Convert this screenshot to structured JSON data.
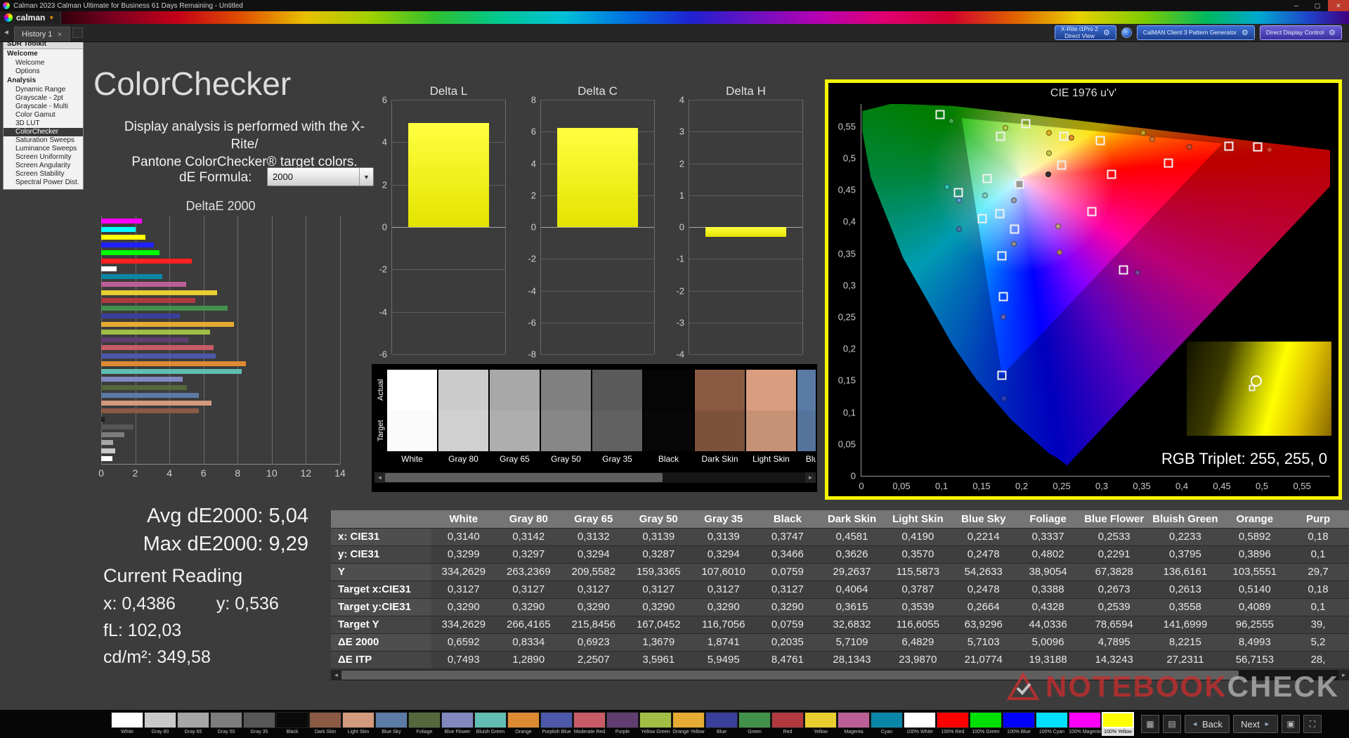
{
  "window": {
    "title": "Calman 2023 Calman Ultimate for Business 61 Days Remaining - Untitled"
  },
  "menu": {
    "logo": "calman"
  },
  "toolbar": {
    "tab": "History 1",
    "meters": [
      {
        "line1": "X-Rite i1Pro 2",
        "line2": "Direct View"
      },
      {
        "line1": "CalMAN Client 3 Pattern Generator",
        "line2": ""
      },
      {
        "line1": "Direct Display Control",
        "line2": ""
      }
    ]
  },
  "sidebar": {
    "header": "SDR Toolkit",
    "sections": [
      {
        "label": "Welcome",
        "items": [
          {
            "label": "Welcome"
          },
          {
            "label": "Options"
          }
        ]
      },
      {
        "label": "Analysis",
        "items": [
          {
            "label": "Dynamic Range"
          },
          {
            "label": "Grayscale - 2pt"
          },
          {
            "label": "Grayscale - Multi"
          },
          {
            "label": "Color Gamut"
          },
          {
            "label": "3D LUT"
          },
          {
            "label": "ColorChecker",
            "selected": true
          },
          {
            "label": "Saturation Sweeps"
          },
          {
            "label": "Luminance Sweeps"
          },
          {
            "label": "Screen Uniformity"
          },
          {
            "label": "Screen Angularity"
          },
          {
            "label": "Screen Stability"
          },
          {
            "label": "Spectral Power Dist."
          }
        ]
      }
    ]
  },
  "main": {
    "title": "ColorChecker",
    "description_line1": "Display analysis is performed with the X-Rite/",
    "description_line2": "Pantone ColorChecker® target colors.",
    "de_formula_label": "dE Formula:",
    "de_formula_value": "2000"
  },
  "chart_data": [
    {
      "type": "bar",
      "orientation": "horizontal",
      "title": "DeltaE 2000",
      "xlim": [
        0,
        14
      ],
      "xticks": [
        0,
        2,
        4,
        6,
        8,
        10,
        12,
        14
      ],
      "series": [
        {
          "name": "dE2000 per patch (top to bottom)",
          "points": [
            {
              "label": "100% Magenta",
              "value": 2.4,
              "color": "#ff00ff"
            },
            {
              "label": "100% Cyan",
              "value": 2.0,
              "color": "#00ffff"
            },
            {
              "label": "100% Yellow",
              "value": 2.6,
              "color": "#ffff00"
            },
            {
              "label": "100% Blue",
              "value": 3.1,
              "color": "#2020ff"
            },
            {
              "label": "100% Green",
              "value": 3.4,
              "color": "#00ff00"
            },
            {
              "label": "100% Red",
              "value": 5.3,
              "color": "#ff2020"
            },
            {
              "label": "100% White",
              "value": 0.9,
              "color": "#ffffff"
            },
            {
              "label": "Cyan",
              "value": 3.6,
              "color": "#0a87a8"
            },
            {
              "label": "Magenta",
              "value": 5.0,
              "color": "#bb5f97"
            },
            {
              "label": "Yellow",
              "value": 6.8,
              "color": "#e8ce30"
            },
            {
              "label": "Red",
              "value": 5.5,
              "color": "#b03a3f"
            },
            {
              "label": "Green",
              "value": 7.4,
              "color": "#41914b"
            },
            {
              "label": "Blue",
              "value": 4.6,
              "color": "#3a3f9b"
            },
            {
              "label": "Orange Yellow",
              "value": 7.8,
              "color": "#e5ab32"
            },
            {
              "label": "Yellow Green",
              "value": 6.4,
              "color": "#a2bf45"
            },
            {
              "label": "Purple",
              "value": 5.1,
              "color": "#613e70"
            },
            {
              "label": "Moderate Red",
              "value": 6.6,
              "color": "#c75b68"
            },
            {
              "label": "Purplish Blue",
              "value": 6.7,
              "color": "#4d59a8"
            },
            {
              "label": "Orange",
              "value": 8.4993,
              "color": "#dd8a33"
            },
            {
              "label": "Bluish Green",
              "value": 8.2215,
              "color": "#62bdb2"
            },
            {
              "label": "Blue Flower",
              "value": 4.7895,
              "color": "#8289c0"
            },
            {
              "label": "Foliage",
              "value": 5.0096,
              "color": "#55683c"
            },
            {
              "label": "Blue Sky",
              "value": 5.7103,
              "color": "#5c7ba5"
            },
            {
              "label": "Light Skin",
              "value": 6.4829,
              "color": "#d39a7d"
            },
            {
              "label": "Dark Skin",
              "value": 5.7109,
              "color": "#8a5a44"
            },
            {
              "label": "Black",
              "value": 0.2035,
              "color": "#222222"
            },
            {
              "label": "Gray 35",
              "value": 1.8741,
              "color": "#575757"
            },
            {
              "label": "Gray 50",
              "value": 1.3679,
              "color": "#7d7d7d"
            },
            {
              "label": "Gray 65",
              "value": 0.6923,
              "color": "#a6a6a6"
            },
            {
              "label": "Gray 80",
              "value": 0.8334,
              "color": "#c9c9c9"
            },
            {
              "label": "White",
              "value": 0.6592,
              "color": "#ffffff"
            }
          ]
        }
      ]
    },
    {
      "type": "bar",
      "title": "Delta L",
      "ylim": [
        -6,
        6
      ],
      "ytick_step": 2,
      "values": [
        4.9
      ],
      "bar_color": "#ffff00"
    },
    {
      "type": "bar",
      "title": "Delta C",
      "ylim": [
        -8,
        8
      ],
      "ytick_step": 2,
      "values": [
        6.25
      ],
      "bar_color": "#ffff00"
    },
    {
      "type": "bar",
      "title": "Delta H",
      "ylim": [
        -4,
        4
      ],
      "ytick_step": 1,
      "values": [
        -0.3
      ],
      "bar_color": "#ffff00"
    },
    {
      "type": "scatter",
      "title": "CIE 1976 u'v'",
      "xlim": [
        0,
        0.585
      ],
      "ylim": [
        0,
        0.585
      ],
      "scale_max": 0.585,
      "ticks": {
        "values": [
          0,
          0.05,
          0.1,
          0.15,
          0.2,
          0.25,
          0.3,
          0.35,
          0.4,
          0.45,
          0.5,
          0.55
        ],
        "labels": [
          "0",
          "0,05",
          "0,1",
          "0,15",
          "0,2",
          "0,25",
          "0,3",
          "0,35",
          "0,4",
          "0,45",
          "0,5",
          "0,55"
        ]
      },
      "targets": [
        {
          "u": 0.098,
          "v": 0.568
        },
        {
          "u": 0.205,
          "v": 0.554
        },
        {
          "u": 0.174,
          "v": 0.534
        },
        {
          "u": 0.253,
          "v": 0.534
        },
        {
          "u": 0.298,
          "v": 0.527
        },
        {
          "u": 0.459,
          "v": 0.519
        },
        {
          "u": 0.495,
          "v": 0.518
        },
        {
          "u": 0.383,
          "v": 0.492
        },
        {
          "u": 0.25,
          "v": 0.489
        },
        {
          "u": 0.312,
          "v": 0.474
        },
        {
          "u": 0.157,
          "v": 0.468
        },
        {
          "u": 0.197,
          "v": 0.459,
          "filled": true
        },
        {
          "u": 0.121,
          "v": 0.446
        },
        {
          "u": 0.288,
          "v": 0.416
        },
        {
          "u": 0.173,
          "v": 0.412
        },
        {
          "u": 0.151,
          "v": 0.405
        },
        {
          "u": 0.191,
          "v": 0.388
        },
        {
          "u": 0.175,
          "v": 0.346
        },
        {
          "u": 0.327,
          "v": 0.324
        },
        {
          "u": 0.177,
          "v": 0.282
        },
        {
          "u": 0.175,
          "v": 0.158
        }
      ],
      "measured": [
        {
          "u": 0.112,
          "v": 0.559,
          "color": "#3fae49"
        },
        {
          "u": 0.18,
          "v": 0.547,
          "color": "#b6cf3c"
        },
        {
          "u": 0.234,
          "v": 0.54,
          "color": "#e4b322"
        },
        {
          "u": 0.262,
          "v": 0.532,
          "color": "#e0912c"
        },
        {
          "u": 0.352,
          "v": 0.54,
          "color": "#c8a020"
        },
        {
          "u": 0.363,
          "v": 0.53,
          "color": "#d6742e"
        },
        {
          "u": 0.41,
          "v": 0.518,
          "color": "#cf4a30"
        },
        {
          "u": 0.51,
          "v": 0.513,
          "color": "#e43c2a"
        },
        {
          "u": 0.234,
          "v": 0.508,
          "color": "#c9c94a"
        },
        {
          "u": 0.233,
          "v": 0.474,
          "color": "#303030"
        },
        {
          "u": 0.107,
          "v": 0.455,
          "color": "#2ec4b6"
        },
        {
          "u": 0.154,
          "v": 0.441,
          "color": "#7fd4c0"
        },
        {
          "u": 0.19,
          "v": 0.434,
          "color": "#9aa0a6"
        },
        {
          "u": 0.122,
          "v": 0.433,
          "color": "#58a0d0"
        },
        {
          "u": 0.246,
          "v": 0.393,
          "color": "#c0a080"
        },
        {
          "u": 0.122,
          "v": 0.388,
          "color": "#4a7ab0"
        },
        {
          "u": 0.19,
          "v": 0.365,
          "color": "#8a8f94"
        },
        {
          "u": 0.247,
          "v": 0.352,
          "color": "#b08060"
        },
        {
          "u": 0.345,
          "v": 0.32,
          "color": "#8040a0"
        },
        {
          "u": 0.177,
          "v": 0.25,
          "color": "#6060c0"
        },
        {
          "u": 0.178,
          "v": 0.122,
          "color": "#3040c0"
        }
      ]
    }
  ],
  "swatch_compare": {
    "row_labels": [
      "Actual",
      "Target"
    ],
    "patches": [
      {
        "name": "White",
        "actual": "#ffffff",
        "target": "#fbfbfb"
      },
      {
        "name": "Gray 80",
        "actual": "#cbcbcb",
        "target": "#d0d0d0"
      },
      {
        "name": "Gray 65",
        "actual": "#a8a8a8",
        "target": "#aeaeae"
      },
      {
        "name": "Gray 50",
        "actual": "#808080",
        "target": "#878787"
      },
      {
        "name": "Gray 35",
        "actual": "#5a5a5a",
        "target": "#616161"
      },
      {
        "name": "Black",
        "actual": "#050505",
        "target": "#070707"
      },
      {
        "name": "Dark Skin",
        "actual": "#8c5a43",
        "target": "#7c523d"
      },
      {
        "name": "Light Skin",
        "actual": "#d99d80",
        "target": "#c79176"
      },
      {
        "name": "Blue Sky",
        "actual": "#5a7aa6",
        "target": "#56739c"
      }
    ]
  },
  "cie": {
    "rgb_triplet": "RGB Triplet: 255, 255, 0"
  },
  "stats": {
    "avg": "Avg dE2000: 5,04",
    "max": "Max dE2000: 9,29",
    "current_heading": "Current Reading",
    "x_value": "x: 0,4386",
    "y_value": "y: 0,536",
    "fl": "fL: 102,03",
    "cdm2": "cd/m²: 349,58"
  },
  "table": {
    "columns": [
      "White",
      "Gray 80",
      "Gray 65",
      "Gray 50",
      "Gray 35",
      "Black",
      "Dark Skin",
      "Light Skin",
      "Blue Sky",
      "Foliage",
      "Blue Flower",
      "Bluish Green",
      "Orange",
      "Purp"
    ],
    "rows": [
      {
        "label": "x: CIE31",
        "values": [
          "0,3140",
          "0,3142",
          "0,3132",
          "0,3139",
          "0,3139",
          "0,3747",
          "0,4581",
          "0,4190",
          "0,2214",
          "0,3337",
          "0,2533",
          "0,2233",
          "0,5892",
          "0,18"
        ]
      },
      {
        "label": "y: CIE31",
        "values": [
          "0,3299",
          "0,3297",
          "0,3294",
          "0,3287",
          "0,3294",
          "0,3466",
          "0,3626",
          "0,3570",
          "0,2478",
          "0,4802",
          "0,2291",
          "0,3795",
          "0,3896",
          "0,1"
        ]
      },
      {
        "label": "Y",
        "values": [
          "334,2629",
          "263,2369",
          "209,5582",
          "159,3365",
          "107,6010",
          "0,0759",
          "29,2637",
          "115,5873",
          "54,2633",
          "38,9054",
          "67,3828",
          "136,6161",
          "103,5551",
          "29,7"
        ]
      },
      {
        "label": "Target x:CIE31",
        "values": [
          "0,3127",
          "0,3127",
          "0,3127",
          "0,3127",
          "0,3127",
          "0,3127",
          "0,4064",
          "0,3787",
          "0,2478",
          "0,3388",
          "0,2673",
          "0,2613",
          "0,5140",
          "0,18"
        ]
      },
      {
        "label": "Target y:CIE31",
        "values": [
          "0,3290",
          "0,3290",
          "0,3290",
          "0,3290",
          "0,3290",
          "0,3290",
          "0,3615",
          "0,3539",
          "0,2664",
          "0,4328",
          "0,2539",
          "0,3558",
          "0,4089",
          "0,1"
        ]
      },
      {
        "label": "Target Y",
        "values": [
          "334,2629",
          "266,4165",
          "215,8456",
          "167,0452",
          "116,7056",
          "0,0759",
          "32,6832",
          "116,6055",
          "63,9296",
          "44,0336",
          "78,6594",
          "141,6999",
          "96,2555",
          "39,"
        ]
      },
      {
        "label": "ΔE 2000",
        "values": [
          "0,6592",
          "0,8334",
          "0,6923",
          "1,3679",
          "1,8741",
          "0,2035",
          "5,7109",
          "6,4829",
          "5,7103",
          "5,0096",
          "4,7895",
          "8,2215",
          "8,4993",
          "5,2"
        ]
      },
      {
        "label": "ΔE ITP",
        "values": [
          "0,7493",
          "1,2890",
          "2,2507",
          "3,5961",
          "5,9495",
          "8,4761",
          "28,1343",
          "23,9870",
          "21,0774",
          "19,3188",
          "14,3243",
          "27,2311",
          "56,7153",
          "28,"
        ]
      }
    ]
  },
  "patch_bar": {
    "patches": [
      {
        "name": "White",
        "color": "#ffffff"
      },
      {
        "name": "Gray 80",
        "color": "#c9c9c9"
      },
      {
        "name": "Gray 65",
        "color": "#a6a6a6"
      },
      {
        "name": "Gray 50",
        "color": "#7d7d7d"
      },
      {
        "name": "Gray 35",
        "color": "#575757"
      },
      {
        "name": "Black",
        "color": "#0a0a0a"
      },
      {
        "name": "Dark Skin",
        "color": "#8a5a44"
      },
      {
        "name": "Light Skin",
        "color": "#d39a7d"
      },
      {
        "name": "Blue Sky",
        "color": "#5c7ba5"
      },
      {
        "name": "Foliage",
        "color": "#55683c"
      },
      {
        "name": "Blue Flower",
        "color": "#8289c0"
      },
      {
        "name": "Bluish Green",
        "color": "#62bdb2"
      },
      {
        "name": "Orange",
        "color": "#dd8a33"
      },
      {
        "name": "Purplish Blue",
        "color": "#4d59a8"
      },
      {
        "name": "Moderate Red",
        "color": "#c75b68"
      },
      {
        "name": "Purple",
        "color": "#613e70"
      },
      {
        "name": "Yellow Green",
        "color": "#a2bf45"
      },
      {
        "name": "Orange Yellow",
        "color": "#e5ab32"
      },
      {
        "name": "Blue",
        "color": "#3a3f9b"
      },
      {
        "name": "Green",
        "color": "#41914b"
      },
      {
        "name": "Red",
        "color": "#b03a3f"
      },
      {
        "name": "Yellow",
        "color": "#e8ce30"
      },
      {
        "name": "Magenta",
        "color": "#bb5f97"
      },
      {
        "name": "Cyan",
        "color": "#0a87a8"
      },
      {
        "name": "100% White",
        "color": "#ffffff"
      },
      {
        "name": "100% Red",
        "color": "#ff0000"
      },
      {
        "name": "100% Green",
        "color": "#00e000"
      },
      {
        "name": "100% Blue",
        "color": "#0000ff"
      },
      {
        "name": "100% Cyan",
        "color": "#00e0ff"
      },
      {
        "name": "100% Magenta",
        "color": "#ff00ff"
      },
      {
        "name": "100% Yellow",
        "color": "#ffff00",
        "selected": true
      }
    ]
  },
  "nav": {
    "back_label": "Back",
    "next_label": "Next"
  },
  "watermark": {
    "part1": "NOTEBOOK",
    "part2": "CHECK"
  }
}
